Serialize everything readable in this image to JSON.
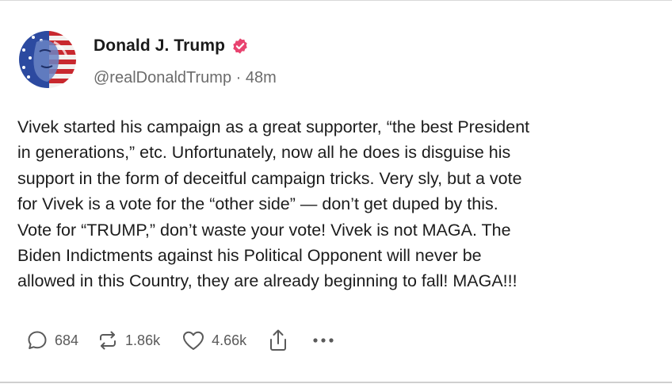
{
  "post": {
    "author": {
      "display_name": "Donald J. Trump",
      "handle": "@realDonaldTrump",
      "separator": "·",
      "time_ago": "48m",
      "avatar_icon": "avatar-flag-portrait",
      "verified_icon": "verified-badge-icon",
      "verified_color": "#e8436f"
    },
    "text": "Vivek started his campaign as a great supporter, “the best President\nin generations,” etc. Unfortunately, now all he does is disguise his\nsupport in the form of deceitful campaign tricks. Very sly, but a vote\nfor Vivek is a vote for the “other side” — don’t get duped by this.\nVote for “TRUMP,” don’t waste your vote! Vivek is not MAGA. The\nBiden Indictments against his Political Opponent will never be\nallowed in this Country, they are already beginning to fall! MAGA!!!",
    "actions": {
      "reply": {
        "icon": "reply-bubble-icon",
        "count": "684"
      },
      "retruth": {
        "icon": "retruth-arrows-icon",
        "count": "1.86k"
      },
      "like": {
        "icon": "heart-icon",
        "count": "4.66k"
      },
      "share": {
        "icon": "share-upload-icon"
      },
      "more": {
        "icon": "more-dots-icon"
      }
    }
  }
}
